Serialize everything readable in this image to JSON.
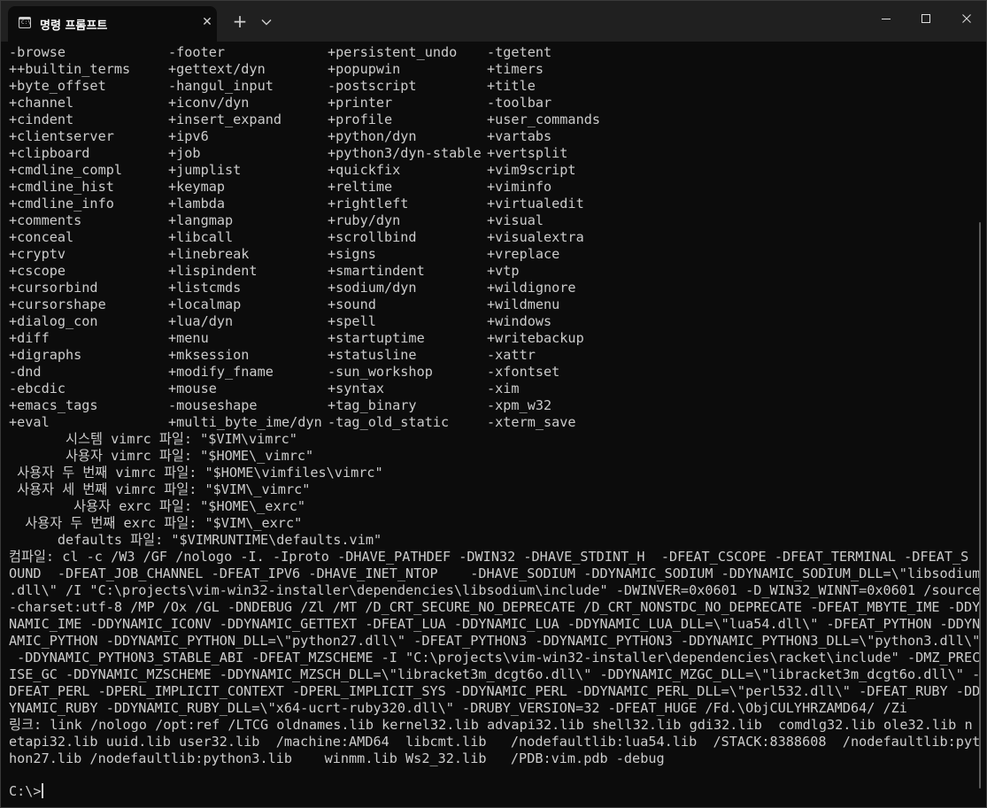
{
  "tab": {
    "title": "명령 프롬프트",
    "icon": "cmd-icon",
    "close": "✕"
  },
  "titlebar": {
    "new_tab": "+",
    "dropdown_icon": "chevron-down-icon"
  },
  "window_controls": {
    "minimize_icon": "minimize-icon",
    "maximize_icon": "maximize-icon",
    "close_icon": "close-icon"
  },
  "features": [
    [
      "-browse",
      "-footer",
      "+persistent_undo",
      "-tgetent"
    ],
    [
      "++builtin_terms",
      "+gettext/dyn",
      "+popupwin",
      "+timers"
    ],
    [
      "+byte_offset",
      "-hangul_input",
      "-postscript",
      "+title"
    ],
    [
      "+channel",
      "+iconv/dyn",
      "+printer",
      "-toolbar"
    ],
    [
      "+cindent",
      "+insert_expand",
      "+profile",
      "+user_commands"
    ],
    [
      "+clientserver",
      "+ipv6",
      "+python/dyn",
      "+vartabs"
    ],
    [
      "+clipboard",
      "+job",
      "+python3/dyn-stable",
      "+vertsplit"
    ],
    [
      "+cmdline_compl",
      "+jumplist",
      "+quickfix",
      "+vim9script"
    ],
    [
      "+cmdline_hist",
      "+keymap",
      "+reltime",
      "+viminfo"
    ],
    [
      "+cmdline_info",
      "+lambda",
      "+rightleft",
      "+virtualedit"
    ],
    [
      "+comments",
      "+langmap",
      "+ruby/dyn",
      "+visual"
    ],
    [
      "+conceal",
      "+libcall",
      "+scrollbind",
      "+visualextra"
    ],
    [
      "+cryptv",
      "+linebreak",
      "+signs",
      "+vreplace"
    ],
    [
      "+cscope",
      "+lispindent",
      "+smartindent",
      "+vtp"
    ],
    [
      "+cursorbind",
      "+listcmds",
      "+sodium/dyn",
      "+wildignore"
    ],
    [
      "+cursorshape",
      "+localmap",
      "+sound",
      "+wildmenu"
    ],
    [
      "+dialog_con",
      "+lua/dyn",
      "+spell",
      "+windows"
    ],
    [
      "+diff",
      "+menu",
      "+startuptime",
      "+writebackup"
    ],
    [
      "+digraphs",
      "+mksession",
      "+statusline",
      "-xattr"
    ],
    [
      "-dnd",
      "+modify_fname",
      "-sun_workshop",
      "-xfontset"
    ],
    [
      "-ebcdic",
      "+mouse",
      "+syntax",
      "-xim"
    ],
    [
      "+emacs_tags",
      "-mouseshape",
      "+tag_binary",
      "-xpm_w32"
    ],
    [
      "+eval",
      "+multi_byte_ime/dyn",
      "-tag_old_static",
      "-xterm_save"
    ]
  ],
  "vimrc_lines": [
    "       시스템 vimrc 파일: \"$VIM\\vimrc\"",
    "       사용자 vimrc 파일: \"$HOME\\_vimrc\"",
    " 사용자 두 번째 vimrc 파일: \"$HOME\\vimfiles\\vimrc\"",
    " 사용자 세 번째 vimrc 파일: \"$VIM\\_vimrc\"",
    "        사용자 exrc 파일: \"$HOME\\_exrc\"",
    "  사용자 두 번째 exrc 파일: \"$VIM\\_exrc\"",
    "      defaults 파일: \"$VIMRUNTIME\\defaults.vim\""
  ],
  "compile_lines": [
    "컴파일: cl -c /W3 /GF /nologo -I. -Iproto -DHAVE_PATHDEF -DWIN32 -DHAVE_STDINT_H  -DFEAT_CSCOPE -DFEAT_TERMINAL -DFEAT_S",
    "OUND  -DFEAT_JOB_CHANNEL -DFEAT_IPV6 -DHAVE_INET_NTOP    -DHAVE_SODIUM -DDYNAMIC_SODIUM -DDYNAMIC_SODIUM_DLL=\\\"libsodium",
    ".dll\\\" /I \"C:\\projects\\vim-win32-installer\\dependencies\\libsodium\\include\" -DWINVER=0x0601 -D_WIN32_WINNT=0x0601 /source",
    "-charset:utf-8 /MP /Ox /GL -DNDEBUG /Zl /MT /D_CRT_SECURE_NO_DEPRECATE /D_CRT_NONSTDC_NO_DEPRECATE -DFEAT_MBYTE_IME -DDY",
    "NAMIC_IME -DDYNAMIC_ICONV -DDYNAMIC_GETTEXT -DFEAT_LUA -DDYNAMIC_LUA -DDYNAMIC_LUA_DLL=\\\"lua54.dll\\\" -DFEAT_PYTHON -DDYN",
    "AMIC_PYTHON -DDYNAMIC_PYTHON_DLL=\\\"python27.dll\\\" -DFEAT_PYTHON3 -DDYNAMIC_PYTHON3 -DDYNAMIC_PYTHON3_DLL=\\\"python3.dll\\\"",
    " -DDYNAMIC_PYTHON3_STABLE_ABI -DFEAT_MZSCHEME -I \"C:\\projects\\vim-win32-installer\\dependencies\\racket\\include\" -DMZ_PREC",
    "ISE_GC -DDYNAMIC_MZSCHEME -DDYNAMIC_MZSCH_DLL=\\\"libracket3m_dcgt6o.dll\\\" -DDYNAMIC_MZGC_DLL=\\\"libracket3m_dcgt6o.dll\\\" -",
    "DFEAT_PERL -DPERL_IMPLICIT_CONTEXT -DPERL_IMPLICIT_SYS -DDYNAMIC_PERL -DDYNAMIC_PERL_DLL=\\\"perl532.dll\\\" -DFEAT_RUBY -DD",
    "YNAMIC_RUBY -DDYNAMIC_RUBY_DLL=\\\"x64-ucrt-ruby320.dll\\\" -DRUBY_VERSION=32 -DFEAT_HUGE /Fd.\\ObjCULYHRZAMD64/ /Zi"
  ],
  "link_lines": [
    "링크: link /nologo /opt:ref /LTCG oldnames.lib kernel32.lib advapi32.lib shell32.lib gdi32.lib  comdlg32.lib ole32.lib n",
    "etapi32.lib uuid.lib user32.lib  /machine:AMD64  libcmt.lib   /nodefaultlib:lua54.lib  /STACK:8388608  /nodefaultlib:pyt",
    "hon27.lib /nodefaultlib:python3.lib    winmm.lib Ws2_32.lib   /PDB:vim.pdb -debug"
  ],
  "prompt": "C:\\>",
  "colors": {
    "background": "#0c0c0c",
    "text": "#cccccc",
    "titlebar": "#202020"
  }
}
